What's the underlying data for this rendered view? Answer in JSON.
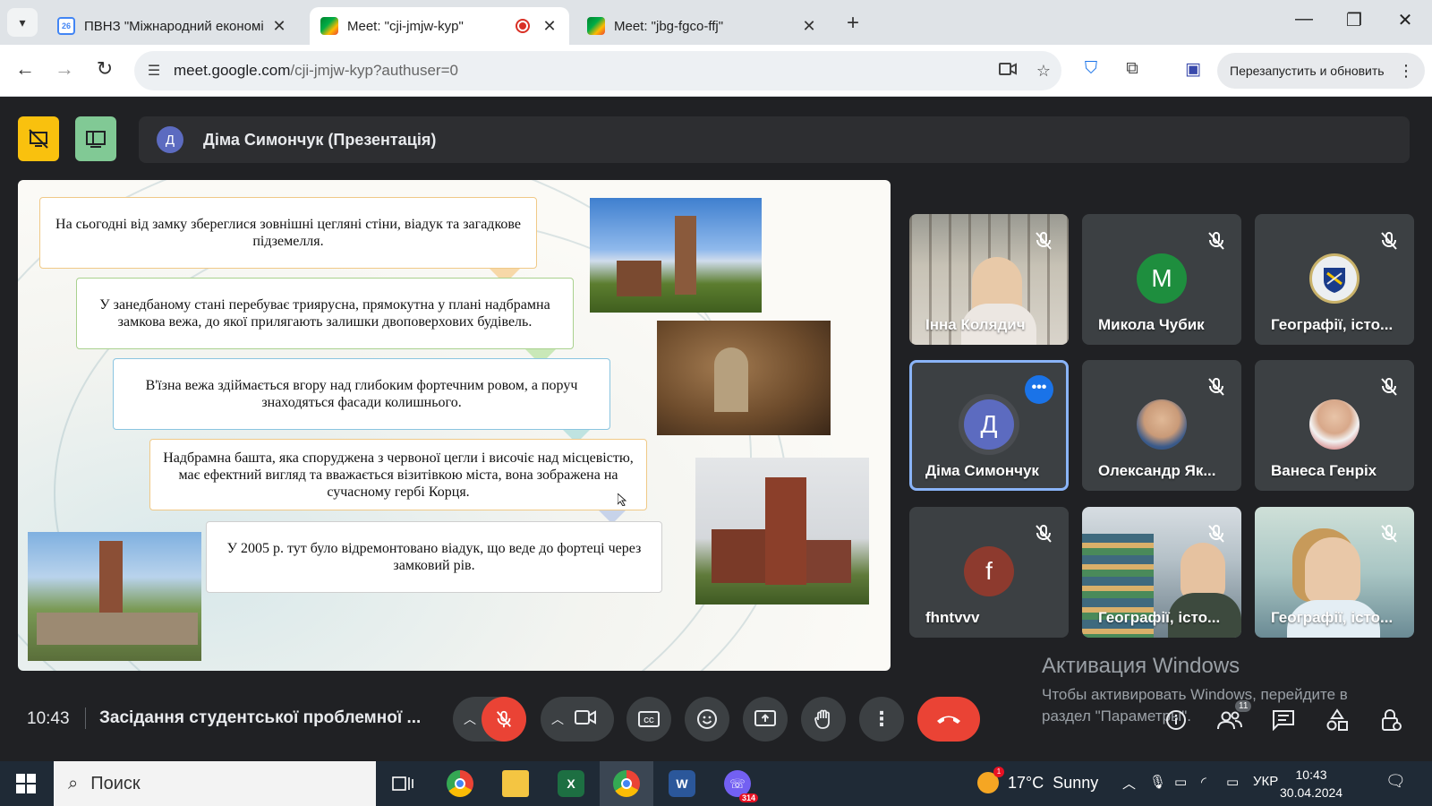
{
  "browser": {
    "tabs": [
      {
        "label": "ПВНЗ \"Міжнародний економі",
        "icon": "calendar-icon"
      },
      {
        "label": "Meet: \"cji-jmjw-kyp\"",
        "icon": "meet-icon",
        "recording": true,
        "active": true
      },
      {
        "label": "Meet: \"jbg-fgco-ffj\"",
        "icon": "meet-icon"
      }
    ],
    "calendar_fav_text": "26",
    "url_host": "meet.google.com",
    "url_path": "/cji-jmjw-kyp?authuser=0",
    "relaunch_label": "Перезапустить и обновить"
  },
  "meet": {
    "presenter_initial": "Д",
    "presenter_label": "Діма Симончук (Презентація)",
    "slide": {
      "boxes": [
        "На сьогодні від замку збереглися зовнішні цегляні стіни, віадук та загадкове підземелля.",
        "У занедбаному стані перебуває триярусна, прямокутна у плані надбрамна замкова вежа, до якої прилягають залишки двоповерхових будівель.",
        "В'їзна вежа здіймається вгору над глибоким фортечним ровом, а поруч знаходяться фасади колишнього.",
        "Надбрамна башта, яка споруджена з червоної цегли і височіє над місцевістю, має ефектний вигляд та вважається візитівкою міста, вона зображена на сучасному гербі Корця.",
        "У 2005 р. тут було відремонтовано віадук, що веде до фортеці через замковий рів."
      ]
    },
    "participants": [
      {
        "name": "Інна Колядич",
        "type": "video",
        "muted": true
      },
      {
        "name": "Микола Чубик",
        "initial": "M",
        "color": "#1e8e3e",
        "muted": true
      },
      {
        "name": "Географії, істо...",
        "type": "logo",
        "muted": true
      },
      {
        "name": "Діма Симончук",
        "initial": "Д",
        "color": "#5c6bc0",
        "active": true
      },
      {
        "name": "Олександр Як...",
        "type": "photo",
        "muted": true
      },
      {
        "name": "Ванеса Генріх",
        "type": "photo",
        "muted": true
      },
      {
        "name": "fhntvvv",
        "initial": "f",
        "color": "#8d3a2e",
        "muted": true
      },
      {
        "name": "Географії, істо...",
        "type": "video",
        "muted": true
      },
      {
        "name": "Географії, істо...",
        "type": "video",
        "muted": true
      }
    ],
    "activation_title": "Активация Windows",
    "activation_text_1": "Чтобы активировать Windows, перейдите в",
    "activation_text_2": "раздел \"Параметры\".",
    "time": "10:43",
    "meeting_title": "Засідання студентської проблемної ...",
    "people_count": "11"
  },
  "taskbar": {
    "search_placeholder": "Поиск",
    "weather_temp": "17°C",
    "weather_text": "Sunny",
    "weather_badge": "1",
    "viber_badge": "314",
    "lang": "УКР",
    "clock_time": "10:43",
    "clock_date": "30.04.2024"
  },
  "colors": {
    "meet_bg": "#202124",
    "end_call": "#ea4335",
    "active_tile_border": "#8ab4f8",
    "yellow_btn": "#f9c10e",
    "green_btn": "#81c995"
  }
}
